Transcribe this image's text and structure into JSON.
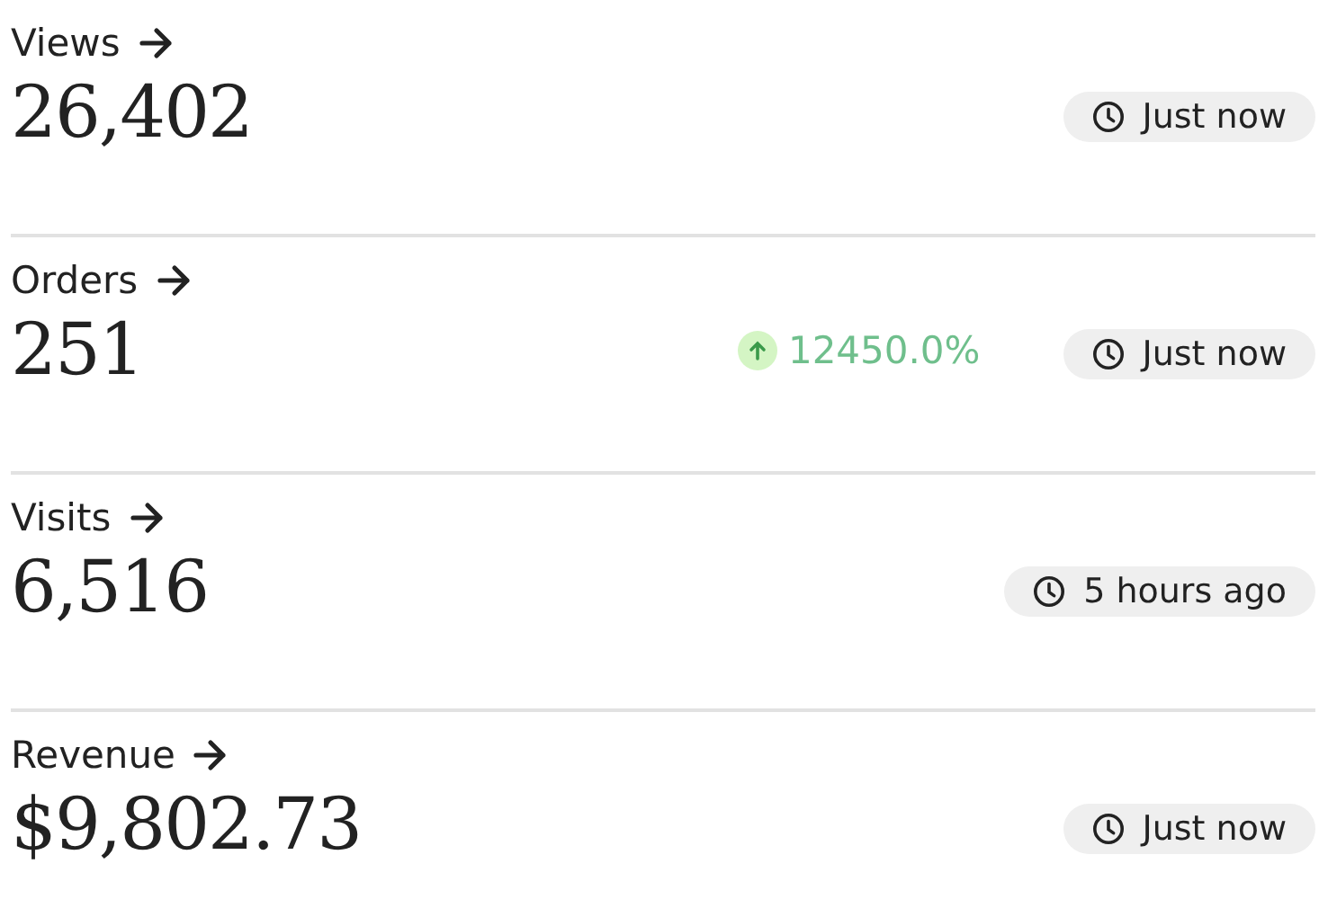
{
  "metrics": [
    {
      "label": "Views",
      "value": "26,402",
      "updated": "Just now"
    },
    {
      "label": "Orders",
      "value": "251",
      "change": {
        "increase": true,
        "text": "12450.0%"
      },
      "updated": "Just now"
    },
    {
      "label": "Visits",
      "value": "6,516",
      "updated": "5 hours ago"
    },
    {
      "label": "Revenue",
      "value": "$9,802.73",
      "updated": "Just now"
    }
  ]
}
